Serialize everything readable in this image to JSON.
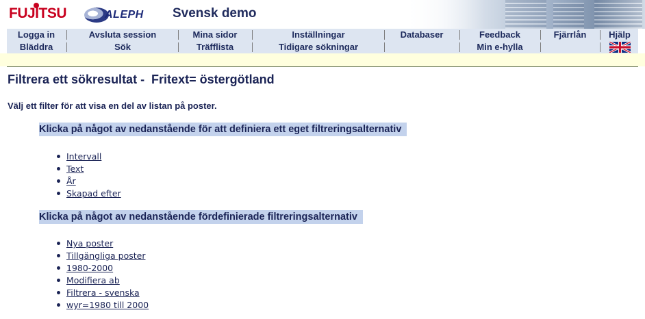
{
  "header": {
    "brand_logo": "FUJITSU",
    "product_logo": "ALEPH",
    "site_title": "Svensk demo"
  },
  "nav": {
    "row1": [
      "Logga in",
      "Avsluta session",
      "Mina sidor",
      "Inställningar",
      "Databaser",
      "Feedback",
      "Fjärrlån",
      "Hjälp"
    ],
    "row2": [
      "Bläddra",
      "Sök",
      "Träfflista",
      "Tidigare sökningar",
      "",
      "Min e-hylla",
      "",
      ""
    ],
    "language_flag_icon": "uk-flag-icon"
  },
  "content": {
    "title": "Filtrera ett sökresultat -  Fritext= östergötland",
    "instruction": "Välj ett filter för att visa en del av listan på poster.",
    "custom_heading": "Klicka på något av nedanstående för att definiera ett eget filtreringsalternativ",
    "custom_links": [
      "Intervall",
      "Text",
      "År",
      "Skapad efter"
    ],
    "predefined_heading": "Klicka på något av nedanstående fördefinierade filtreringsalternativ",
    "predefined_links": [
      "Nya poster",
      "Tillgängliga poster",
      "1980-2000",
      "Modifiera ab",
      "Filtrera - svenska",
      "wyr=1980 till 2000"
    ]
  },
  "colors": {
    "brand_red": "#c8001e",
    "nav_background": "#dde5f1",
    "highlight_background": "#c3d2ec",
    "strip_background": "#ffffde",
    "text": "#1a2355"
  }
}
